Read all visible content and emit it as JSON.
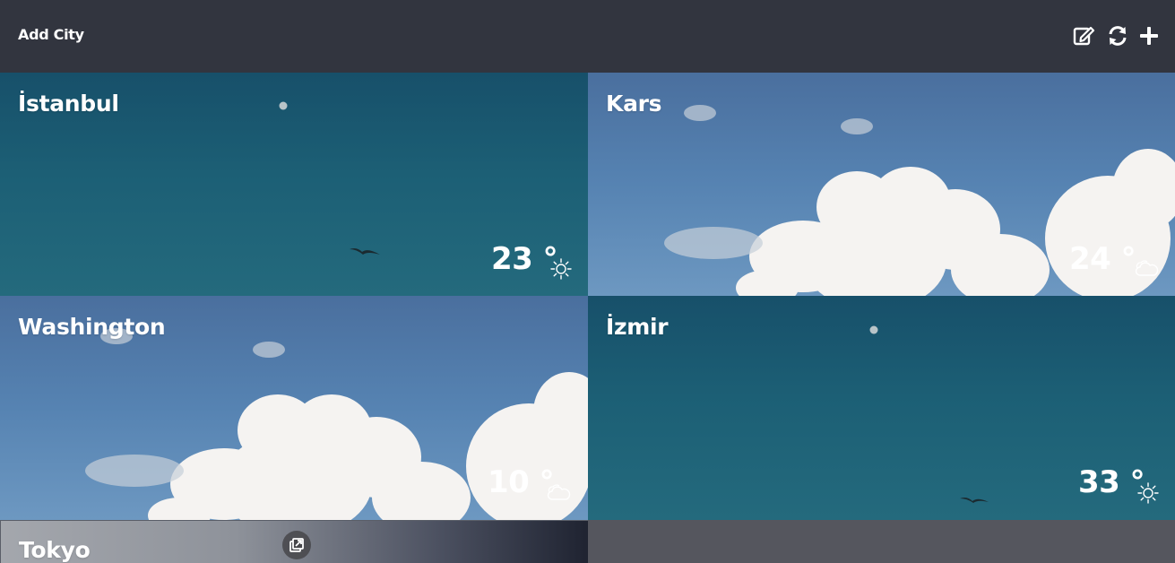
{
  "header": {
    "title": "Add City"
  },
  "toolbar": {
    "icons": [
      "edit-icon",
      "refresh-icon",
      "plus-icon"
    ]
  },
  "cities": [
    {
      "name": "İstanbul",
      "temp": "23 °",
      "condition": "sunny-icon"
    },
    {
      "name": "Kars",
      "temp": "24 °",
      "condition": "cloudy-icon"
    },
    {
      "name": "Washington",
      "temp": "10 °",
      "condition": "cloudy-icon"
    },
    {
      "name": "İzmir",
      "temp": "33 °",
      "condition": "sunny-icon"
    },
    {
      "name": "Tokyo"
    }
  ],
  "colors": {
    "header_bg": "#32353f",
    "teal_bg": "#1c5f75",
    "sky_bg": "#5683b2",
    "empty_bg": "#55565e"
  }
}
